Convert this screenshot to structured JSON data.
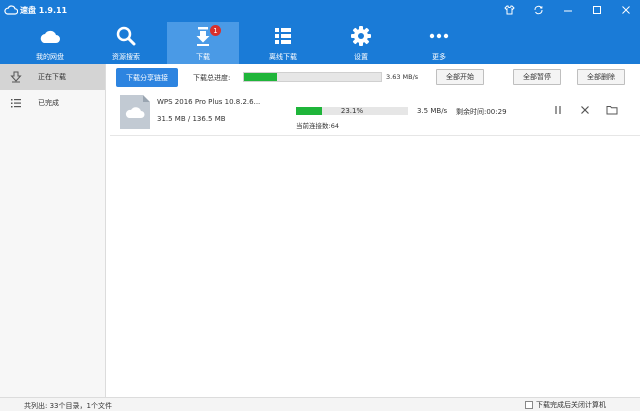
{
  "app": {
    "title": "速盘 1.9.11",
    "icon": "cloud-icon"
  },
  "window_controls": [
    "shirt-icon",
    "refresh-icon",
    "minimize-icon",
    "maximize-icon",
    "close-icon"
  ],
  "nav": {
    "items": [
      {
        "id": "my-disk",
        "label": "我的网盘",
        "icon": "cloud-icon"
      },
      {
        "id": "search",
        "label": "资源搜索",
        "icon": "search-icon"
      },
      {
        "id": "download",
        "label": "下载",
        "icon": "download-icon",
        "badge": "1",
        "active": true
      },
      {
        "id": "offline",
        "label": "离线下载",
        "icon": "list-grid-icon"
      },
      {
        "id": "settings",
        "label": "设置",
        "icon": "gear-icon"
      },
      {
        "id": "more",
        "label": "更多",
        "icon": "more-dots-icon"
      }
    ]
  },
  "sidebar": {
    "items": [
      {
        "label": "正在下载",
        "icon": "downloading-icon",
        "active": true
      },
      {
        "label": "已完成",
        "icon": "completed-list-icon",
        "active": false
      }
    ]
  },
  "toolbar": {
    "share_link_label": "下载分享链接",
    "total_progress_label": "下载总进度:",
    "total_progress": 0.24,
    "total_speed": "3.63 MB/s",
    "start_all_label": "全部开始",
    "pause_all_label": "全部暂停",
    "delete_all_label": "全部删除"
  },
  "tasks": [
    {
      "name": "WPS 2016 Pro Plus 10.8.2.6...",
      "size": "31.5 MB / 136.5 MB",
      "percent_text": "23.1%",
      "progress": 0.231,
      "speed": "3.5 MB/s",
      "remaining": "剩余时间:00:29",
      "connections": "当前连接数:64",
      "icon": "cloud-file-icon"
    }
  ],
  "status": {
    "summary": "共列出: 33个目录，1个文件",
    "shutdown_label": "下载完成后关闭计算机",
    "shutdown_checked": false
  },
  "colors": {
    "brand": "#1a7bd7",
    "active_nav": "#4a9ae6",
    "progress": "#1fb53a",
    "badge": "#d9302c"
  }
}
